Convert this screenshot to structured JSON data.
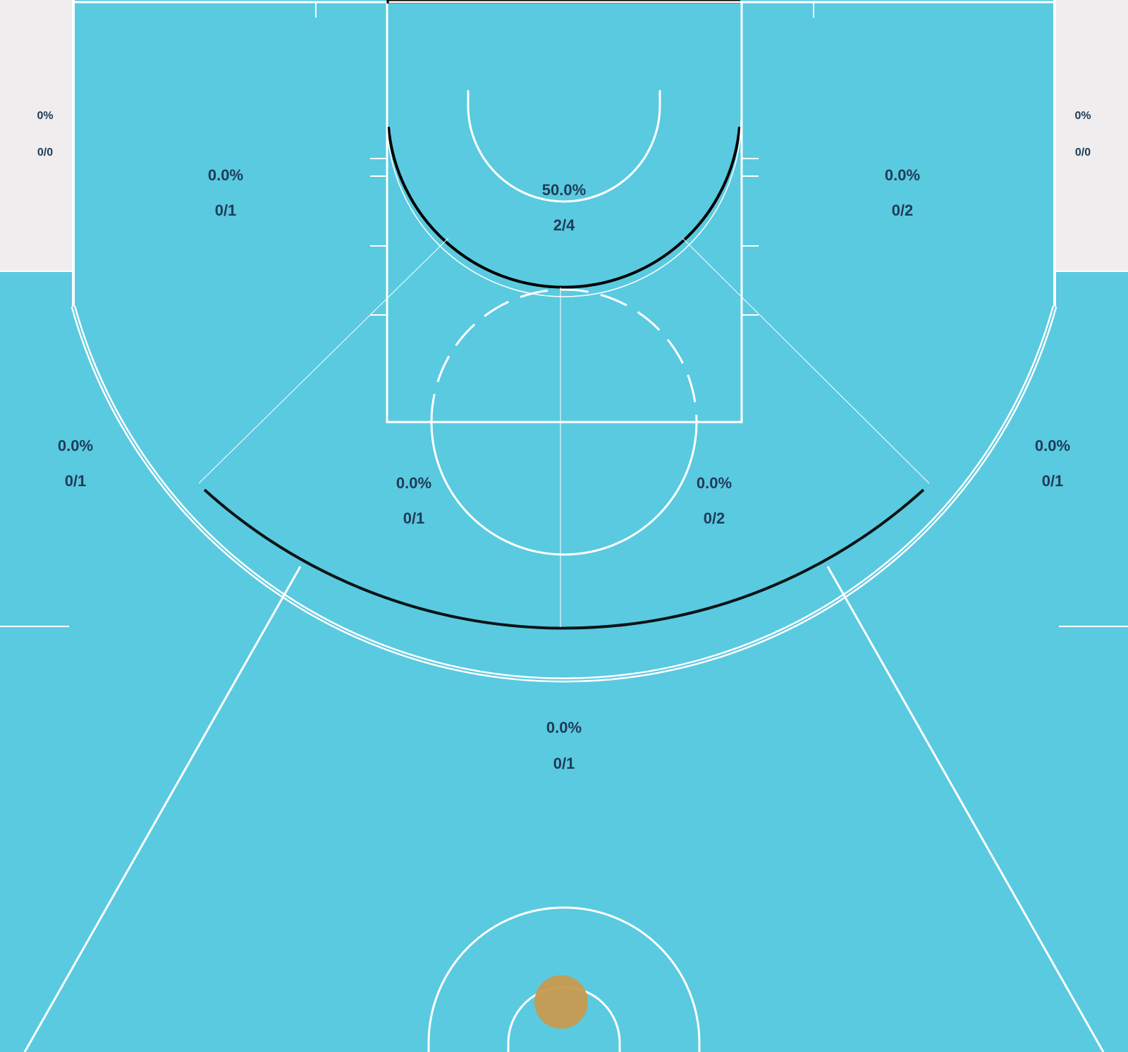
{
  "colors": {
    "court_fill": "#5acae0",
    "outside_fill": "#efeded",
    "line_color": "#ffffff",
    "label_color": "#1f3b57",
    "ball_color": "#c89a4f"
  },
  "chart_data": {
    "type": "shot-chart",
    "zones": [
      {
        "id": "left-corner-three",
        "pct": "0%",
        "made_attempted": "0/0"
      },
      {
        "id": "right-corner-three",
        "pct": "0%",
        "made_attempted": "0/0"
      },
      {
        "id": "left-baseline-mid",
        "pct": "0.0%",
        "made_attempted": "0/1"
      },
      {
        "id": "restricted-paint",
        "pct": "50.0%",
        "made_attempted": "2/4"
      },
      {
        "id": "right-baseline-mid",
        "pct": "0.0%",
        "made_attempted": "0/2"
      },
      {
        "id": "left-wing-three",
        "pct": "0.0%",
        "made_attempted": "0/1"
      },
      {
        "id": "left-elbow-mid",
        "pct": "0.0%",
        "made_attempted": "0/1"
      },
      {
        "id": "right-elbow-mid",
        "pct": "0.0%",
        "made_attempted": "0/2"
      },
      {
        "id": "right-wing-three",
        "pct": "0.0%",
        "made_attempted": "0/1"
      },
      {
        "id": "top-of-key-three",
        "pct": "0.0%",
        "made_attempted": "0/1"
      }
    ]
  }
}
